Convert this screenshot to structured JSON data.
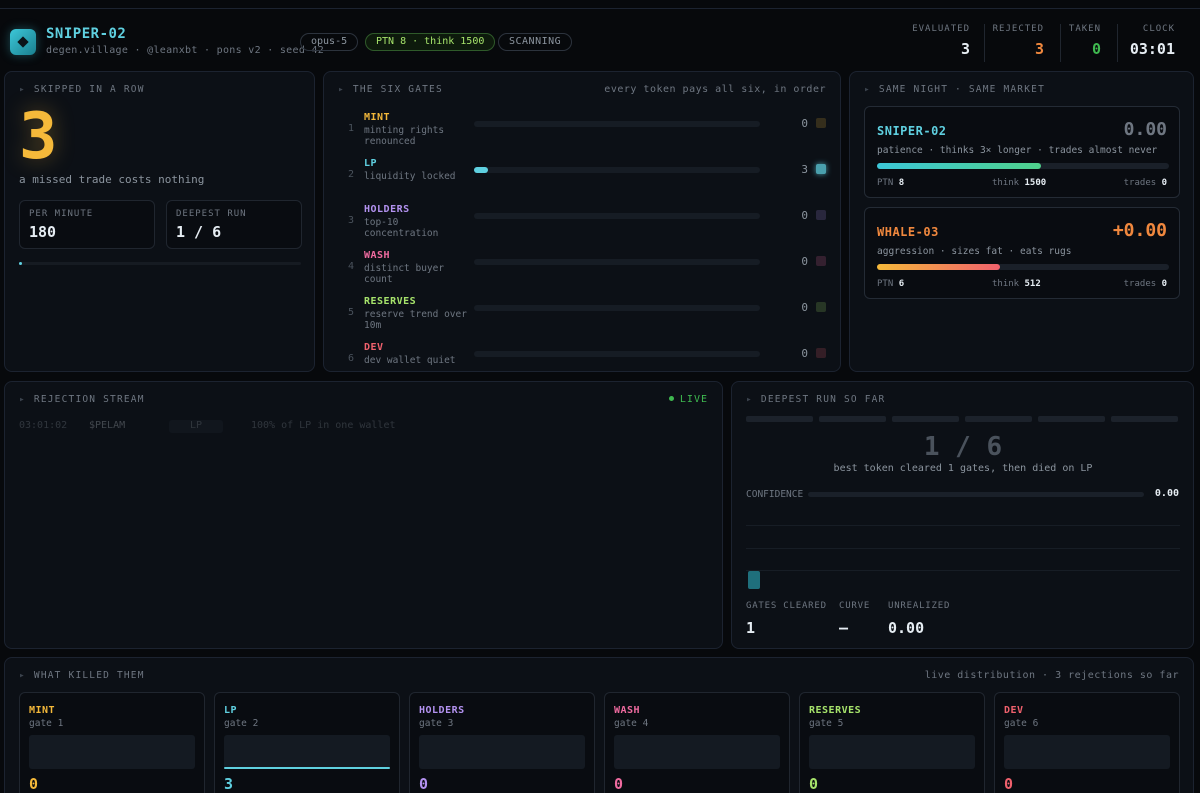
{
  "app": {
    "name": "SNIPER-02",
    "subtitle": "degen.village · @leanxbt · pons v2 · seed 42",
    "model_pill": "opus-5",
    "ptn_pill": "PTN 8 · think 1500",
    "status_pill": "SCANNING"
  },
  "stats": {
    "evaluated_label": "EVALUATED",
    "evaluated": "3",
    "rejected_label": "REJECTED",
    "rejected": "3",
    "taken_label": "TAKEN",
    "taken": "0",
    "clock_label": "CLOCK",
    "clock": "03:01"
  },
  "colors": {
    "accent": "#5fd0e0",
    "amber": "#f5b93a",
    "green": "#3fb950",
    "orange": "#f0883e",
    "mint": "#f5b93a",
    "lp": "#5fd0e0",
    "holders": "#b392f0",
    "wash": "#f06ba0",
    "reserves": "#a6e36b",
    "dev": "#f0616d"
  },
  "skipped": {
    "title": "SKIPPED IN A ROW",
    "count": "3",
    "caption": "a missed trade costs nothing",
    "per_minute_label": "PER MINUTE",
    "per_minute": "180",
    "deepest_label": "DEEPEST RUN",
    "deepest": "1 / 6",
    "progress_fraction": 0.01
  },
  "gates": {
    "title": "THE SIX GATES",
    "note": "every token pays all six, in order",
    "items": [
      {
        "num": "1",
        "name": "MINT",
        "desc": "minting rights renounced",
        "count": "0",
        "fill_fraction": 0
      },
      {
        "num": "2",
        "name": "LP",
        "desc": "liquidity locked",
        "count": "3",
        "fill_fraction": 0.05
      },
      {
        "num": "3",
        "name": "HOLDERS",
        "desc": "top-10 concentration",
        "count": "0",
        "fill_fraction": 0
      },
      {
        "num": "4",
        "name": "WASH",
        "desc": "distinct buyer count",
        "count": "0",
        "fill_fraction": 0
      },
      {
        "num": "5",
        "name": "RESERVES",
        "desc": "reserve trend over 10m",
        "count": "0",
        "fill_fraction": 0
      },
      {
        "num": "6",
        "name": "DEV",
        "desc": "dev wallet quiet",
        "count": "0",
        "fill_fraction": 0
      }
    ]
  },
  "same_night": {
    "title": "SAME NIGHT · SAME MARKET",
    "agents": [
      {
        "name": "SNIPER-02",
        "pnl": "0.00",
        "desc": "patience · thinks 3× longer · trades almost never",
        "ptn_label": "PTN",
        "ptn": "8",
        "think_label": "think",
        "think": "1500",
        "trades_label": "trades",
        "trades": "0",
        "bar_fraction": 0.56
      },
      {
        "name": "WHALE-03",
        "pnl": "+0.00",
        "desc": "aggression · sizes fat · eats rugs",
        "ptn_label": "PTN",
        "ptn": "6",
        "think_label": "think",
        "think": "512",
        "trades_label": "trades",
        "trades": "0",
        "bar_fraction": 0.42
      }
    ]
  },
  "stream": {
    "title": "REJECTION STREAM",
    "live_label": "LIVE",
    "rows": [
      {
        "time": "03:01:02",
        "token": "$PELAM",
        "gate": "LP",
        "reason": "100% of LP in one wallet"
      }
    ]
  },
  "deepest_run": {
    "title": "DEEPEST RUN SO FAR",
    "value": "1 / 6",
    "caption": "best token cleared 1 gates, then died on LP",
    "confidence_label": "CONFIDENCE",
    "confidence": "0.00",
    "gates_cleared_label": "GATES CLEARED",
    "gates_cleared": "1",
    "curve_label": "CURVE",
    "curve": "—",
    "unrealized_label": "UNREALIZED",
    "unrealized": "0.00"
  },
  "killed": {
    "title": "WHAT KILLED THEM",
    "note": "live distribution · 3 rejections so far",
    "cards": [
      {
        "name": "MINT",
        "gate": "gate 1",
        "count": "0",
        "fraction": 0
      },
      {
        "name": "LP",
        "gate": "gate 2",
        "count": "3",
        "fraction": 1
      },
      {
        "name": "HOLDERS",
        "gate": "gate 3",
        "count": "0",
        "fraction": 0
      },
      {
        "name": "WASH",
        "gate": "gate 4",
        "count": "0",
        "fraction": 0
      },
      {
        "name": "RESERVES",
        "gate": "gate 5",
        "count": "0",
        "fraction": 0
      },
      {
        "name": "DEV",
        "gate": "gate 6",
        "count": "0",
        "fraction": 0
      }
    ]
  }
}
